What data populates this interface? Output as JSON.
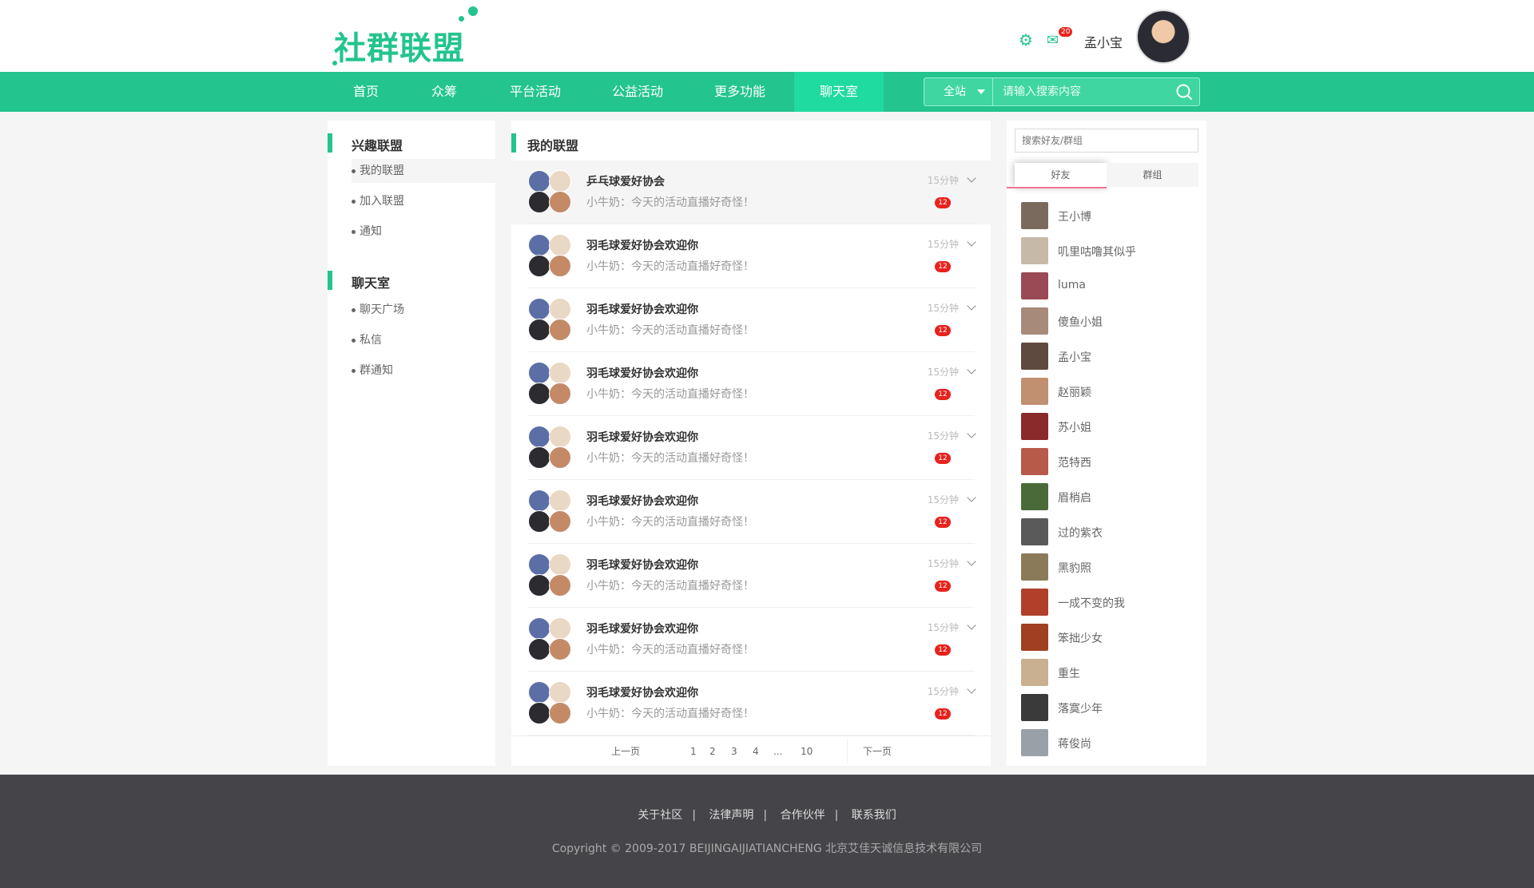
{
  "header": {
    "logo": "社群联盟",
    "mail_count": "20",
    "username": "孟小宝"
  },
  "nav": {
    "items": [
      "首页",
      "众筹",
      "平台活动",
      "公益活动",
      "更多功能",
      "聊天室"
    ],
    "active": "聊天室",
    "search_scope": "全站",
    "search_placeholder": "请输入搜索内容"
  },
  "left": {
    "section1": "兴趣联盟",
    "section1_items": [
      "我的联盟",
      "加入联盟",
      "通知"
    ],
    "section2": "聊天室",
    "section2_items": [
      "聊天广场",
      "私信",
      "群通知"
    ]
  },
  "middle": {
    "title": "我的联盟",
    "rows": [
      {
        "name": "乒乓球爱好协会",
        "msg": "小牛奶：今天的活动直播好奇怪！",
        "time": "15分钟",
        "badge": "12"
      },
      {
        "name": "羽毛球爱好协会欢迎你",
        "msg": "小牛奶：今天的活动直播好奇怪！",
        "time": "15分钟",
        "badge": "12"
      },
      {
        "name": "羽毛球爱好协会欢迎你",
        "msg": "小牛奶：今天的活动直播好奇怪！",
        "time": "15分钟",
        "badge": "12"
      },
      {
        "name": "羽毛球爱好协会欢迎你",
        "msg": "小牛奶：今天的活动直播好奇怪！",
        "time": "15分钟",
        "badge": "12"
      },
      {
        "name": "羽毛球爱好协会欢迎你",
        "msg": "小牛奶：今天的活动直播好奇怪！",
        "time": "15分钟",
        "badge": "12"
      },
      {
        "name": "羽毛球爱好协会欢迎你",
        "msg": "小牛奶：今天的活动直播好奇怪！",
        "time": "15分钟",
        "badge": "12"
      },
      {
        "name": "羽毛球爱好协会欢迎你",
        "msg": "小牛奶：今天的活动直播好奇怪！",
        "time": "15分钟",
        "badge": "12"
      },
      {
        "name": "羽毛球爱好协会欢迎你",
        "msg": "小牛奶：今天的活动直播好奇怪！",
        "time": "15分钟",
        "badge": "12"
      },
      {
        "name": "羽毛球爱好协会欢迎你",
        "msg": "小牛奶：今天的活动直播好奇怪！",
        "time": "15分钟",
        "badge": "12"
      }
    ],
    "pager": {
      "prev": "上一页",
      "pages": [
        "1",
        "2",
        "3",
        "4",
        "...",
        "10"
      ],
      "next": "下一页"
    }
  },
  "right": {
    "search_placeholder": "搜索好友/群组",
    "tabs": [
      "好友",
      "群组"
    ],
    "friends": [
      "王小博",
      "叽里咕噜其似乎",
      "luma",
      "傻鱼小姐",
      "孟小宝",
      "赵丽颖",
      "苏小姐",
      "范特西",
      "眉梢启",
      "过的紫衣",
      "黑豹照",
      "一成不变的我",
      "笨拙少女",
      "重生",
      "落寞少年",
      "蒋俊尚"
    ]
  },
  "footer": {
    "links": [
      "关于社区",
      "法律声明",
      "合作伙伴",
      "联系我们"
    ],
    "copyright": "Copyright © 2009-2017 BEIJINGAIJIATIANCHENG 北京艾佳天诚信息技术有限公司"
  },
  "colors": {
    "primary": "#23c48e",
    "nav_active": "#1fdba0",
    "badge": "#e8221c",
    "tab_underline": "#f27394",
    "footer_bg": "#454549"
  }
}
